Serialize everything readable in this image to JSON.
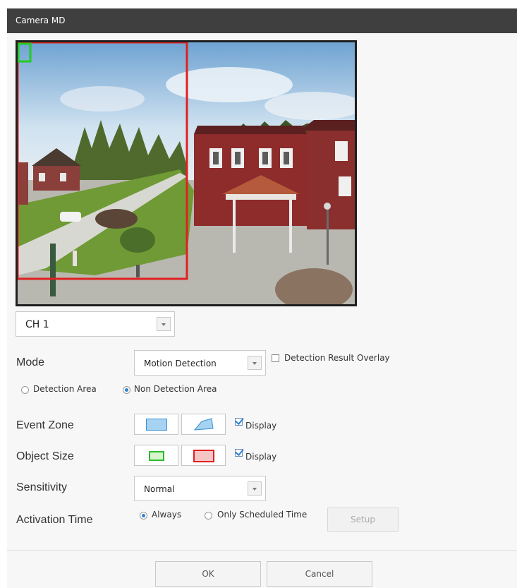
{
  "window": {
    "title": "Camera MD"
  },
  "channel": {
    "selected": "CH 1"
  },
  "mode": {
    "label": "Mode",
    "selected": "Motion Detection",
    "overlay_label": "Detection Result Overlay",
    "overlay_checked": false
  },
  "area": {
    "option1": "Detection Area",
    "option2": "Non Detection Area",
    "selected": "Non Detection Area"
  },
  "event_zone": {
    "label": "Event Zone",
    "display_label": "Display",
    "display_checked": true,
    "rect_icon": "rectangle-zone-icon",
    "polygon_icon": "polygon-zone-icon",
    "color": "#a6d3f2"
  },
  "object_size": {
    "label": "Object Size",
    "display_label": "Display",
    "display_checked": true,
    "min_icon": "min-size-icon",
    "max_icon": "max-size-icon",
    "min_color": "#2bbd2b",
    "max_color": "#e02020"
  },
  "sensitivity": {
    "label": "Sensitivity",
    "selected": "Normal"
  },
  "activation": {
    "label": "Activation Time",
    "option1": "Always",
    "option2": "Only Scheduled Time",
    "selected": "Always",
    "setup_label": "Setup"
  },
  "footer": {
    "ok_label": "OK",
    "cancel_label": "Cancel"
  },
  "video": {
    "description": "camera-preview-image",
    "max_box_color": "#e02020",
    "min_box_color": "#22cc22"
  }
}
